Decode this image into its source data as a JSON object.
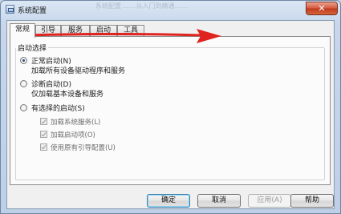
{
  "window": {
    "title": "系统配置",
    "ghost_title": "系统配置 ……从入门到精通……"
  },
  "tabs": [
    {
      "label": "常规",
      "active": true
    },
    {
      "label": "引导",
      "active": false
    },
    {
      "label": "服务",
      "active": false
    },
    {
      "label": "启动",
      "active": false
    },
    {
      "label": "工具",
      "active": false
    }
  ],
  "startup_group": {
    "title": "启动选择",
    "options": [
      {
        "label": "正常启动(N)",
        "description": "加载所有设备驱动程序和服务",
        "selected": true
      },
      {
        "label": "诊断启动(D)",
        "description": "仅加载基本设备和服务",
        "selected": false
      },
      {
        "label": "有选择的启动(S)",
        "selected": false
      }
    ],
    "selective_items": [
      {
        "label": "加载系统服务(L)",
        "checked": true,
        "enabled": false
      },
      {
        "label": "加载启动项(O)",
        "checked": true,
        "enabled": false
      },
      {
        "label": "使用原有引导配置(U)",
        "checked": true,
        "enabled": false
      }
    ]
  },
  "buttons": {
    "ok": "确定",
    "cancel": "取消",
    "apply": "应用(A)",
    "help": "帮助"
  },
  "colors": {
    "annotation_arrow": "#e0231f",
    "close_button": "#c9442a"
  }
}
